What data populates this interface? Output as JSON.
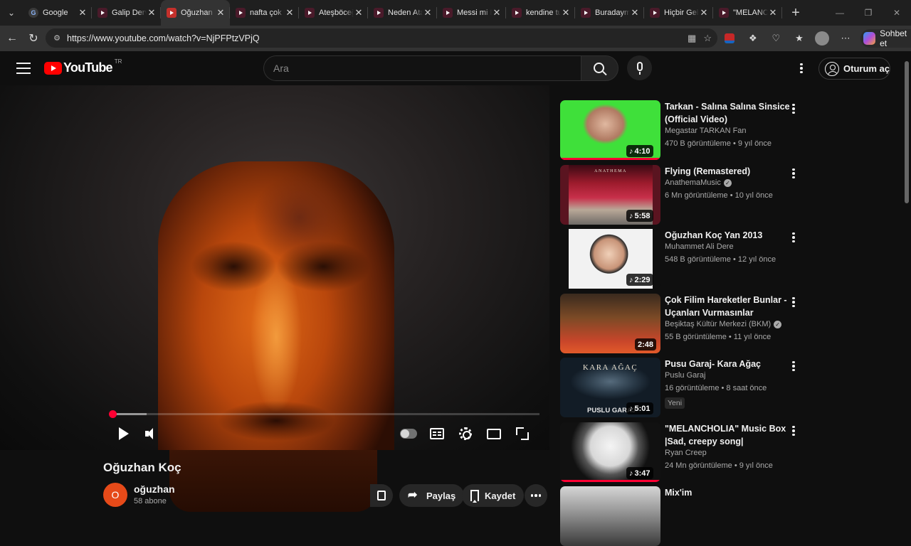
{
  "browser": {
    "tabs": [
      {
        "title": "Google",
        "favicon": "google-icon",
        "active": false
      },
      {
        "title": "Galip Derviş",
        "favicon": "youtube-icon",
        "active": false
      },
      {
        "title": "Oğuzhan Koç",
        "favicon": "youtube-icon",
        "active": true
      },
      {
        "title": "nafta çok fena",
        "favicon": "youtube-icon",
        "active": false
      },
      {
        "title": "Ateşböceği",
        "favicon": "youtube-icon",
        "active": false
      },
      {
        "title": "Neden Atatürk",
        "favicon": "youtube-icon",
        "active": false
      },
      {
        "title": "Messi mi Ronaldo",
        "favicon": "youtube-icon",
        "active": false
      },
      {
        "title": "kendine tut",
        "favicon": "youtube-icon",
        "active": false
      },
      {
        "title": "Buradaymış",
        "favicon": "youtube-icon",
        "active": false
      },
      {
        "title": "Hiçbir Gelir",
        "favicon": "youtube-icon",
        "active": false
      },
      {
        "title": "\"MELANCHOLIA\"",
        "favicon": "youtube-icon",
        "active": false
      }
    ],
    "url": "https://www.youtube.com/watch?v=NjPFPtzVPjQ",
    "copilot_label": "Sohbet et"
  },
  "header": {
    "logo_text": "YouTube",
    "country_code": "TR",
    "search_placeholder": "Ara",
    "signin_label": "Oturum aç"
  },
  "player": {
    "progress_fraction": 0.0,
    "buffered_fraction": 0.08
  },
  "video": {
    "title": "Oğuzhan Koç",
    "channel_initial": "O",
    "channel_name": "oğuzhan",
    "subscribers": "58 abone",
    "share_label": "Paylaş",
    "save_label": "Kaydet"
  },
  "recommendations": [
    {
      "title": "Tarkan - Salına Salına Sinsice (Official Video)",
      "channel": "Megastar TARKAN Fan",
      "verified": false,
      "meta": "470 B görüntüleme • 9 yıl önce",
      "duration": "4:10",
      "music": true,
      "watched": true,
      "new_badge": "",
      "thumb_style": "green"
    },
    {
      "title": "Flying (Remastered)",
      "channel": "AnathemaMusic",
      "verified": true,
      "meta": "6 Mn görüntüleme • 10 yıl önce",
      "duration": "5:58",
      "music": true,
      "watched": false,
      "new_badge": "",
      "thumb_style": "anathema",
      "thumb_text": "ANATHEMA"
    },
    {
      "title": "Oğuzhan Koç Yan 2013",
      "channel": "Muhammet Ali Dere",
      "verified": false,
      "meta": "548 B görüntüleme • 12 yıl önce",
      "duration": "2:29",
      "music": true,
      "watched": false,
      "new_badge": "",
      "thumb_style": "portrait"
    },
    {
      "title": "Çok Filim Hareketler Bunlar - Uçanları Vurmasınlar",
      "channel": "Beşiktaş Kültür Merkezi (BKM)",
      "verified": true,
      "meta": "55 B görüntüleme • 11 yıl önce",
      "duration": "2:48",
      "music": false,
      "watched": false,
      "new_badge": "",
      "thumb_style": "band"
    },
    {
      "title": "Pusu Garaj- Kara Ağaç",
      "channel": "Puslu Garaj",
      "verified": false,
      "meta": "16 görüntüleme • 8 saat önce",
      "duration": "5:01",
      "music": true,
      "watched": false,
      "new_badge": "Yeni",
      "thumb_style": "tree",
      "thumb_text": "KARA AĞAÇ",
      "thumb_text2": "PUSLU GARAJ"
    },
    {
      "title": "\"MELANCHOLIA\" Music Box |Sad, creepy song|",
      "channel": "Ryan Creep",
      "verified": false,
      "meta": "24 Mn görüntüleme • 9 yıl önce",
      "duration": "3:47",
      "music": true,
      "watched": true,
      "new_badge": "",
      "thumb_style": "moon"
    },
    {
      "title": "Mix'im",
      "channel": "",
      "verified": false,
      "meta": "",
      "duration": "",
      "music": false,
      "watched": false,
      "new_badge": "",
      "thumb_style": "mix"
    }
  ],
  "colors": {
    "brand": "#ff0000",
    "progress": "#ff0033",
    "background": "#0f0f0f",
    "secondary_text": "#aaaaaa"
  }
}
